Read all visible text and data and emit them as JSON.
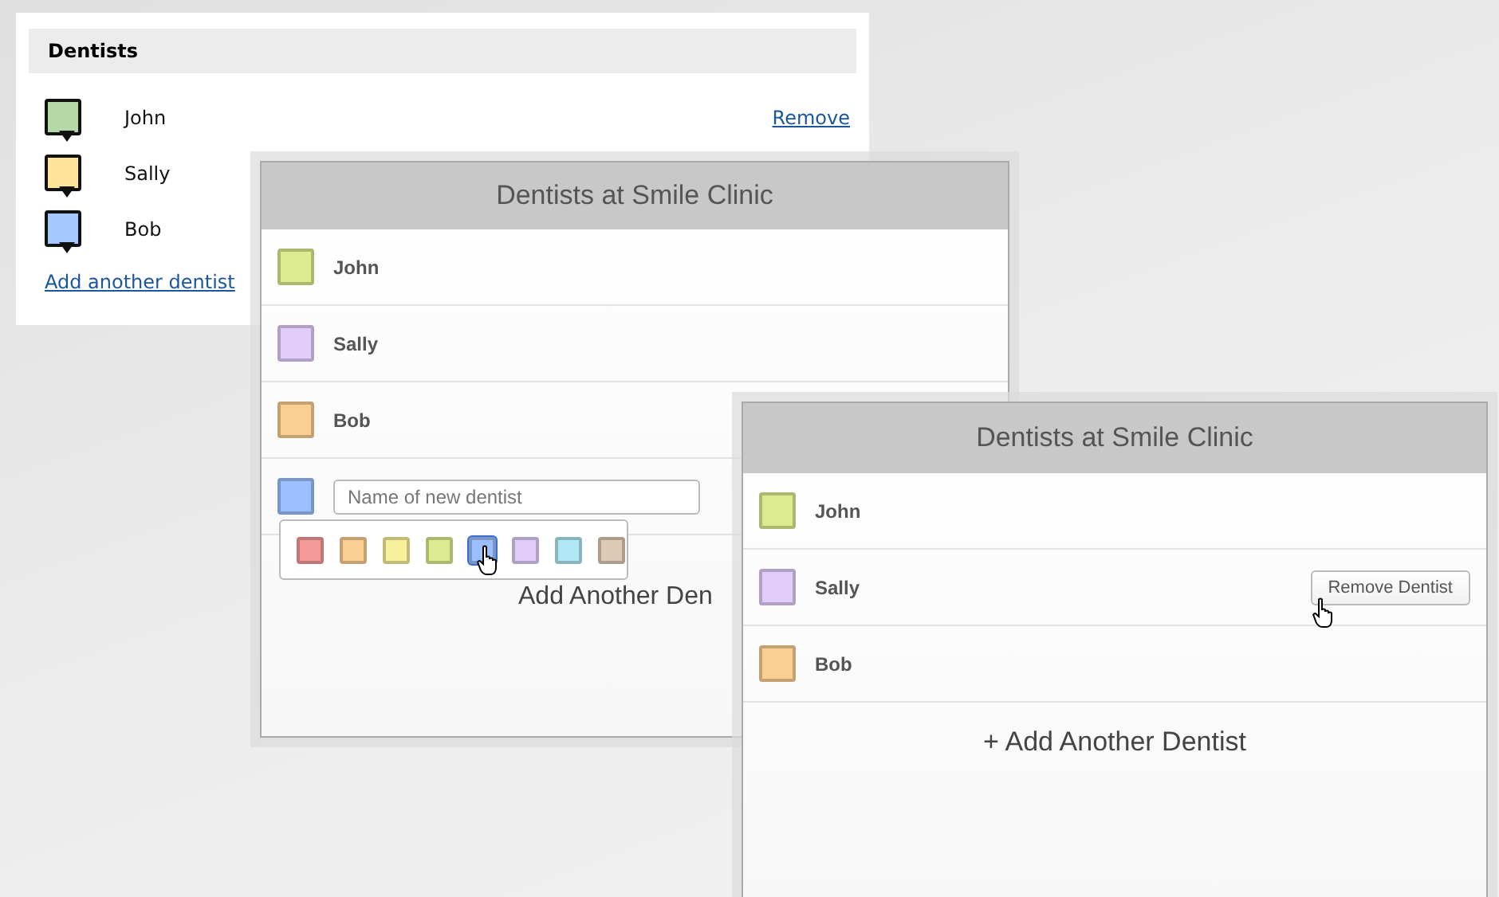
{
  "wireframe": {
    "title": "Dentists",
    "add_link": "Add another dentist",
    "dentists": [
      {
        "name": "John",
        "color": "#b5d9a6",
        "action": "Remove"
      },
      {
        "name": "Sally",
        "color": "#ffe49a"
      },
      {
        "name": "Bob",
        "color": "#a5c8ff"
      }
    ]
  },
  "add_panel": {
    "title": "Dentists at Smile Clinic",
    "dentists": [
      {
        "name": "John",
        "color": "#dceb8f"
      },
      {
        "name": "Sally",
        "color": "#e2cdfa"
      },
      {
        "name": "Bob",
        "color": "#fbcf93"
      }
    ],
    "new_dentist": {
      "color": "#9cc0ff",
      "placeholder": "Name of new dentist"
    },
    "palette": [
      {
        "color": "#f59a9a",
        "selected": false
      },
      {
        "color": "#fbcf93",
        "selected": false
      },
      {
        "color": "#f8f09a",
        "selected": false
      },
      {
        "color": "#dceb8f",
        "selected": false
      },
      {
        "color": "#9cc0ff",
        "selected": true
      },
      {
        "color": "#e2cdfa",
        "selected": false
      },
      {
        "color": "#b0e8f5",
        "selected": false
      },
      {
        "color": "#ddc9b4",
        "selected": false
      }
    ],
    "add_label": "Add Another Den"
  },
  "remove_panel": {
    "title": "Dentists at Smile Clinic",
    "add_label": "+ Add Another Dentist",
    "dentists": [
      {
        "name": "John",
        "color": "#dceb8f"
      },
      {
        "name": "Sally",
        "color": "#e2cdfa",
        "action": "Remove Dentist"
      },
      {
        "name": "Bob",
        "color": "#fbcf93"
      }
    ]
  }
}
